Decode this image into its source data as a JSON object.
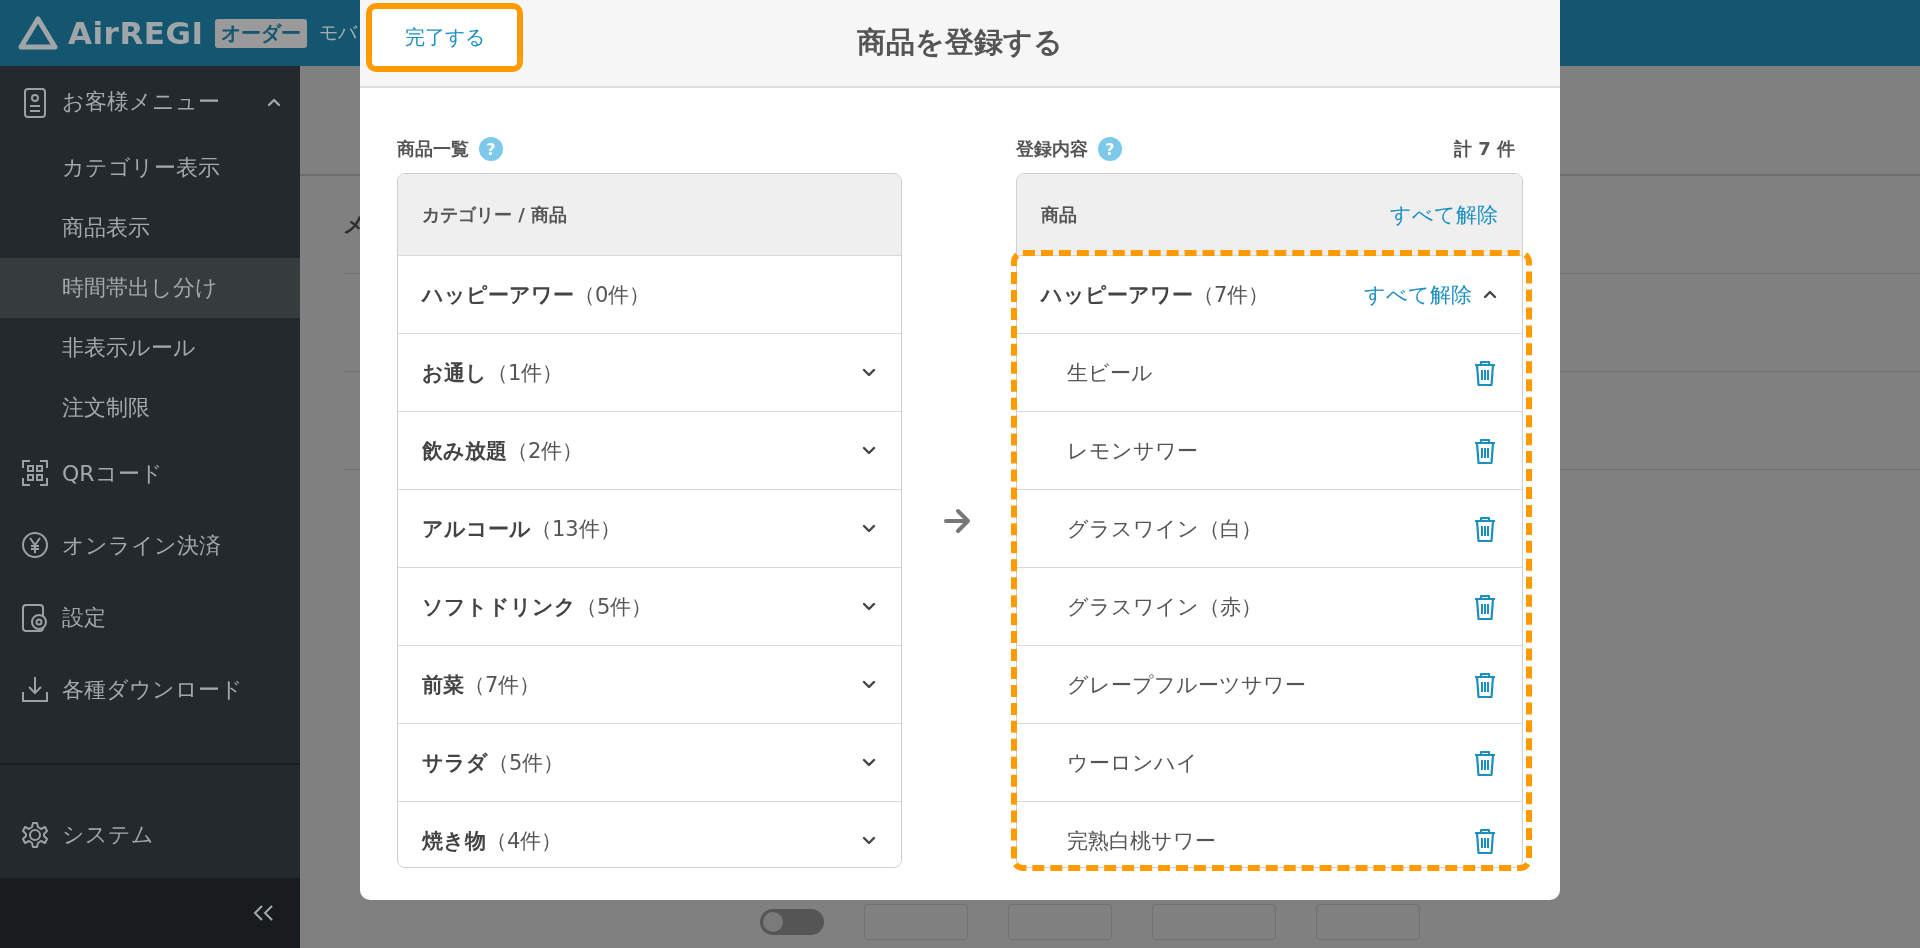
{
  "header": {
    "logo": "AirREGI",
    "badge": "オーダー",
    "title": "モバ"
  },
  "sidebar": {
    "items": [
      {
        "label": "お客様メニュー",
        "expanded": true,
        "children": [
          {
            "label": "カテゴリー表示",
            "selected": false
          },
          {
            "label": "商品表示",
            "selected": false
          },
          {
            "label": "時間帯出し分け",
            "selected": true
          },
          {
            "label": "非表示ルール",
            "selected": false
          },
          {
            "label": "注文制限",
            "selected": false
          }
        ]
      },
      {
        "label": "QRコード"
      },
      {
        "label": "オンライン決済"
      },
      {
        "label": "設定"
      },
      {
        "label": "各種ダウンロード"
      }
    ],
    "system": "システム"
  },
  "page": {
    "rows": [
      "メ"
    ],
    "toggle": {
      "on": false
    }
  },
  "modal": {
    "done_button": {
      "label": "完了する",
      "highlighted": true
    },
    "title": "商品を登録する",
    "left": {
      "label": "商品一覧",
      "help": "?",
      "header": "カテゴリー / 商品",
      "categories": [
        {
          "label": "**ハッピーアワー**（0件）",
          "expandable": false
        },
        {
          "label": "**お通し**（1件）",
          "expandable": true
        },
        {
          "label": "**飲み放題**（2件）",
          "expandable": true
        },
        {
          "label": "**アルコール**（13件）",
          "expandable": true
        },
        {
          "label": "**ソフトドリンク**（5件）",
          "expandable": true
        },
        {
          "label": "**前菜**（7件）",
          "expandable": true
        },
        {
          "label": "**サラダ**（5件）",
          "expandable": true
        },
        {
          "label": "**焼き物**（4件）",
          "expandable": true
        }
      ]
    },
    "right": {
      "label": "登録内容",
      "help": "?",
      "total": "計 7 件",
      "header": "商品",
      "clear_all": "すべて解除",
      "group": {
        "label": "**ハッピーアワー**（7件）",
        "clear_all": "すべて解除",
        "expanded": true,
        "highlighted": true,
        "items": [
          "生ビール",
          "レモンサワー",
          "グラスワイン（白）",
          "グラスワイン（赤）",
          "グレープフルーツサワー",
          "ウーロンハイ",
          "完熟白桃サワー"
        ]
      }
    }
  }
}
